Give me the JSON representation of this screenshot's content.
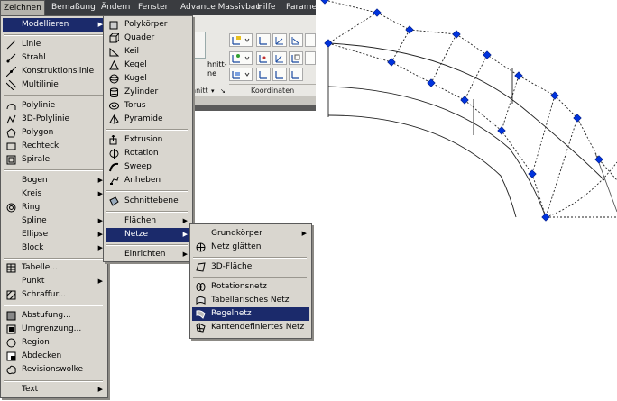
{
  "menubar": {
    "items": [
      "Zeichnen",
      "Bemaßung",
      "Ändern",
      "Fenster",
      "Advance Massivbau",
      "Hilfe",
      "Parame"
    ]
  },
  "ribbon": {
    "panel_fragments": [
      "hnitt-",
      "ne",
      "hnitt"
    ],
    "panel_title": "Koordinaten"
  },
  "zeichnen_menu": {
    "items": [
      {
        "label": "Modellieren",
        "icon": "none",
        "submenu": true,
        "highlighted": true
      },
      {
        "label": "Linie",
        "icon": "line-icon"
      },
      {
        "label": "Strahl",
        "icon": "ray-icon"
      },
      {
        "label": "Konstruktionslinie",
        "icon": "construction-line-icon"
      },
      {
        "label": "Multilinie",
        "icon": "multiline-icon"
      },
      {
        "label": "Polylinie",
        "icon": "polyline-icon"
      },
      {
        "label": "3D-Polylinie",
        "icon": "3d-polyline-icon"
      },
      {
        "label": "Polygon",
        "icon": "polygon-icon"
      },
      {
        "label": "Rechteck",
        "icon": "rectangle-icon"
      },
      {
        "label": "Spirale",
        "icon": "spiral-icon"
      },
      {
        "label": "Bogen",
        "icon": "none",
        "submenu": true
      },
      {
        "label": "Kreis",
        "icon": "none",
        "submenu": true
      },
      {
        "label": "Ring",
        "icon": "ring-icon"
      },
      {
        "label": "Spline",
        "icon": "none",
        "submenu": true
      },
      {
        "label": "Ellipse",
        "icon": "none",
        "submenu": true
      },
      {
        "label": "Block",
        "icon": "none",
        "submenu": true
      },
      {
        "label": "Tabelle...",
        "icon": "table-icon"
      },
      {
        "label": "Punkt",
        "icon": "none",
        "submenu": true
      },
      {
        "label": "Schraffur...",
        "icon": "hatch-icon"
      },
      {
        "label": "Abstufung...",
        "icon": "gradient-icon"
      },
      {
        "label": "Umgrenzung...",
        "icon": "boundary-icon"
      },
      {
        "label": "Region",
        "icon": "region-icon"
      },
      {
        "label": "Abdecken",
        "icon": "wipeout-icon"
      },
      {
        "label": "Revisionswolke",
        "icon": "revision-cloud-icon"
      },
      {
        "label": "Text",
        "icon": "none",
        "submenu": true
      }
    ]
  },
  "modellieren_menu": {
    "items": [
      {
        "label": "Polykörper",
        "icon": "polysolid-icon"
      },
      {
        "label": "Quader",
        "icon": "box-icon"
      },
      {
        "label": "Keil",
        "icon": "wedge-icon"
      },
      {
        "label": "Kegel",
        "icon": "cone-icon"
      },
      {
        "label": "Kugel",
        "icon": "sphere-icon"
      },
      {
        "label": "Zylinder",
        "icon": "cylinder-icon"
      },
      {
        "label": "Torus",
        "icon": "torus-icon"
      },
      {
        "label": "Pyramide",
        "icon": "pyramid-icon"
      },
      {
        "label": "Extrusion",
        "icon": "extrude-icon"
      },
      {
        "label": "Rotation",
        "icon": "revolve-icon"
      },
      {
        "label": "Sweep",
        "icon": "sweep-icon"
      },
      {
        "label": "Anheben",
        "icon": "loft-icon"
      },
      {
        "label": "Schnittebene",
        "icon": "section-plane-icon"
      },
      {
        "label": "Flächen",
        "icon": "none",
        "submenu": true
      },
      {
        "label": "Netze",
        "icon": "none",
        "submenu": true,
        "highlighted": true
      },
      {
        "label": "Einrichten",
        "icon": "none",
        "submenu": true
      }
    ]
  },
  "netze_menu": {
    "items": [
      {
        "label": "Grundkörper",
        "icon": "none",
        "submenu": true
      },
      {
        "label": "Netz glätten",
        "icon": "smooth-mesh-icon"
      },
      {
        "label": "3D-Fläche",
        "icon": "3d-face-icon"
      },
      {
        "label": "Rotationsnetz",
        "icon": "revolved-mesh-icon"
      },
      {
        "label": "Tabellarisches Netz",
        "icon": "tabulated-mesh-icon"
      },
      {
        "label": "Regelnetz",
        "icon": "ruled-mesh-icon",
        "highlighted": true
      },
      {
        "label": "Kantendefiniertes Netz",
        "icon": "edge-mesh-icon"
      }
    ]
  },
  "colors": {
    "menubar_bg": "#3a3c40",
    "menu_bg": "#d9d6cf",
    "highlight": "#1b2a6b",
    "grip_blue": "#0033dd"
  }
}
